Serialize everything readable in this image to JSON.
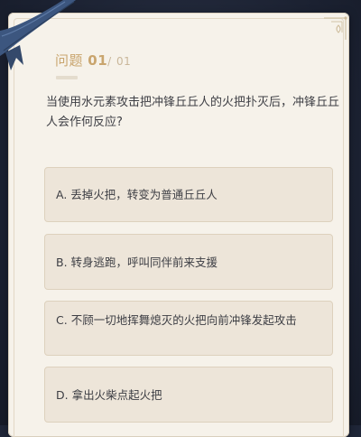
{
  "question": {
    "label": "问题",
    "current": "01",
    "separator": "/",
    "total": "01",
    "text": "当使用水元素攻击把冲锋丘丘人的火把扑灭后，冲锋丘丘人会作何反应?"
  },
  "options": [
    {
      "letter": "A.",
      "text": "丢掉火把，转变为普通丘丘人"
    },
    {
      "letter": "B.",
      "text": "转身逃跑，呼叫同伴前来支援"
    },
    {
      "letter": "C.",
      "text": "不顾一切地挥舞熄灭的火把向前冲锋发起攻击"
    },
    {
      "letter": "D.",
      "text": "拿出火柴点起火把"
    }
  ],
  "colors": {
    "card_background": "#f6f2ea",
    "option_background": "#ede5d9",
    "accent_gold": "#c9a56e",
    "ribbon_blue": "#3c567f",
    "text_dark": "#3d3e44"
  },
  "icons": {
    "ribbon": "bookmark-ribbon-icon",
    "corner": "corner-ornament-icon"
  }
}
